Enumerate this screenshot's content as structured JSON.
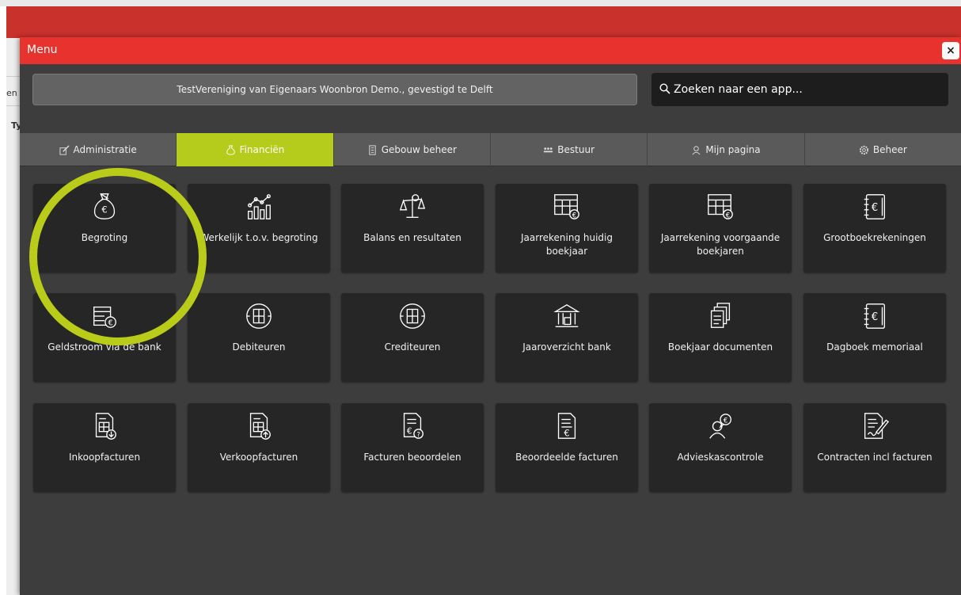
{
  "background": {
    "fragment_1": "en",
    "fragment_2": "Ty"
  },
  "modal": {
    "title": "Menu",
    "close_label": "×"
  },
  "org_name": "TestVereniging van Eigenaars Woonbron Demo., gevestigd te Delft",
  "search": {
    "placeholder": "Zoeken naar een app..."
  },
  "tabs": [
    {
      "label": "Administratie",
      "icon": "edit-icon",
      "active": false
    },
    {
      "label": "Financiën",
      "icon": "money-bag-icon",
      "active": true
    },
    {
      "label": "Gebouw beheer",
      "icon": "building-icon",
      "active": false
    },
    {
      "label": "Bestuur",
      "icon": "people-icon",
      "active": false
    },
    {
      "label": "Mijn pagina",
      "icon": "user-icon",
      "active": false
    },
    {
      "label": "Beheer",
      "icon": "gear-icon",
      "active": false
    }
  ],
  "tiles": [
    {
      "label": "Begroting",
      "icon": "money-bag-icon"
    },
    {
      "label": "Werkelijk t.o.v. begroting",
      "icon": "bar-chart-icon"
    },
    {
      "label": "Balans en resultaten",
      "icon": "scale-icon"
    },
    {
      "label": "Jaarrekening huidig boekjaar",
      "icon": "spreadsheet-euro-icon"
    },
    {
      "label": "Jaarrekening voorgaande boekjaren",
      "icon": "spreadsheet-euro-icon"
    },
    {
      "label": "Grootboekrekeningen",
      "icon": "ledger-euro-icon"
    },
    {
      "label": "Geldstroom via de bank",
      "icon": "cashflow-icon"
    },
    {
      "label": "Debiteuren",
      "icon": "calculator-circle-icon"
    },
    {
      "label": "Crediteuren",
      "icon": "calculator-circle-icon"
    },
    {
      "label": "Jaaroverzicht bank",
      "icon": "bank-icon"
    },
    {
      "label": "Boekjaar documenten",
      "icon": "documents-icon"
    },
    {
      "label": "Dagboek memoriaal",
      "icon": "journal-euro-icon"
    },
    {
      "label": "Inkoopfacturen",
      "icon": "invoice-in-icon"
    },
    {
      "label": "Verkoopfacturen",
      "icon": "invoice-out-icon"
    },
    {
      "label": "Facturen beoordelen",
      "icon": "invoice-question-icon"
    },
    {
      "label": "Beoordeelde facturen",
      "icon": "invoice-euro-icon"
    },
    {
      "label": "Advieskascontrole",
      "icon": "advisor-icon"
    },
    {
      "label": "Contracten incl facturen",
      "icon": "contract-sign-icon"
    }
  ],
  "colors": {
    "header_red": "#e8322d",
    "accent_green": "#b6cc1c",
    "highlight_circle": "#b9cc1a",
    "tile_bg": "#262626"
  }
}
